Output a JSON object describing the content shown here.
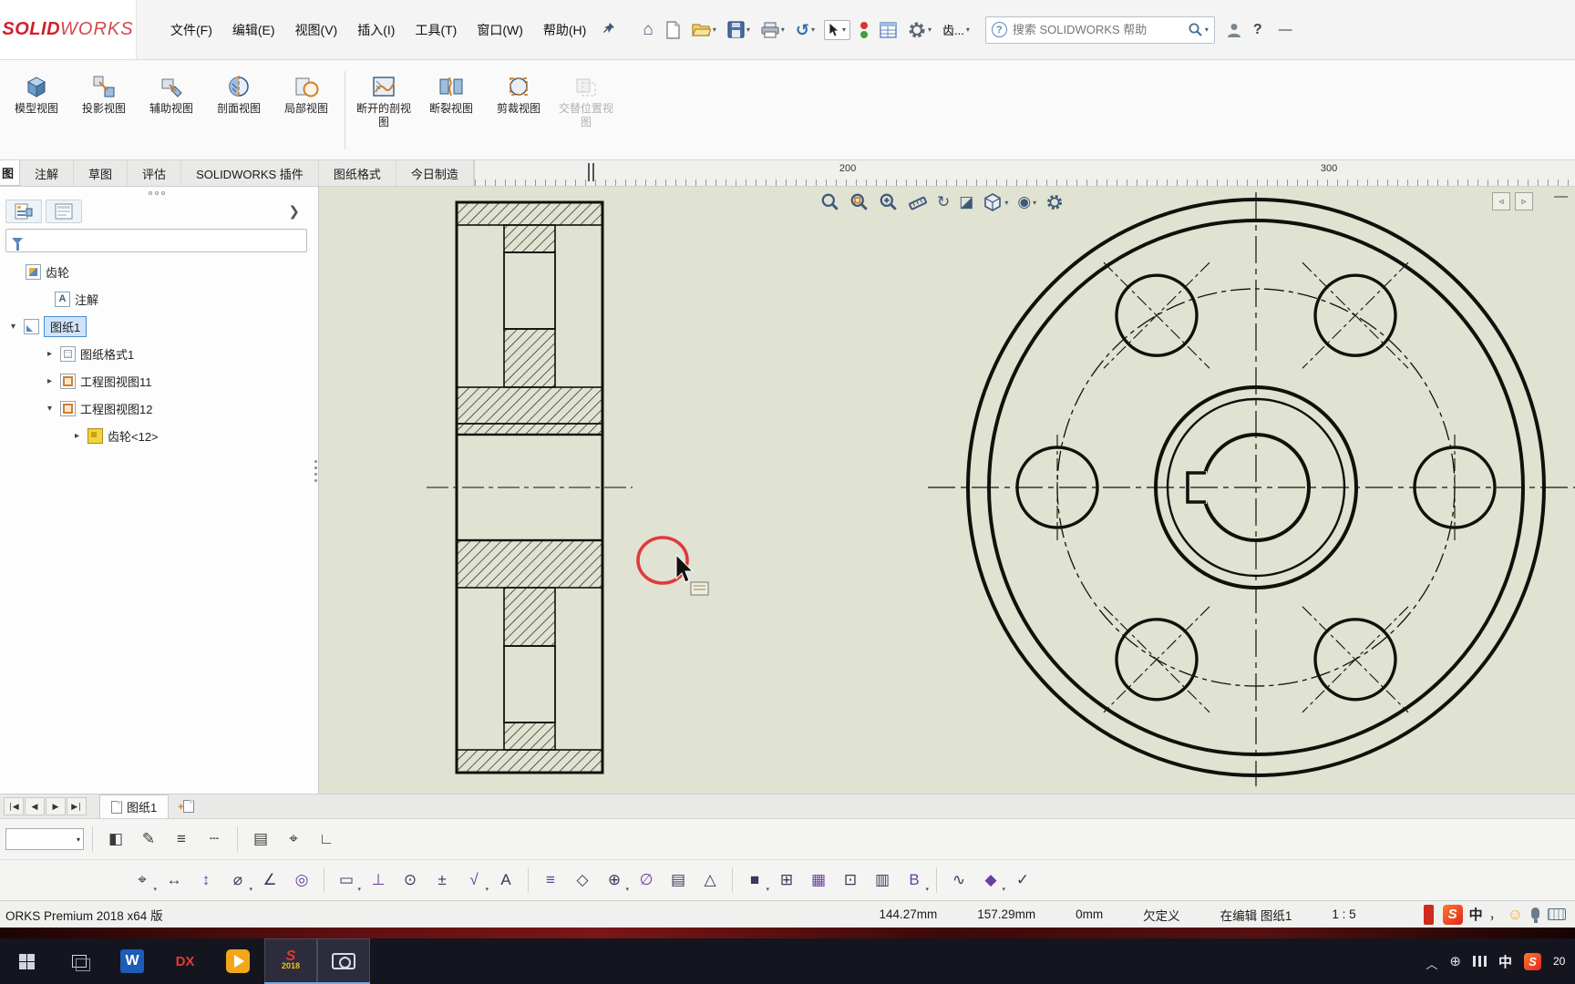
{
  "app": {
    "logo_solid": "SOLID",
    "logo_works": "WORKS",
    "premium": "ORKS Premium 2018 x64 版"
  },
  "menu_bar": {
    "items": [
      "文件(F)",
      "编辑(E)",
      "视图(V)",
      "插入(I)",
      "工具(T)",
      "窗口(W)",
      "帮助(H)"
    ],
    "recent_doc": "齿...",
    "search_placeholder": "搜索 SOLIDWORKS 帮助"
  },
  "ribbon": {
    "buttons": [
      {
        "label": "模型视图"
      },
      {
        "label": "投影视图"
      },
      {
        "label": "辅助视图"
      },
      {
        "label": "剖面视图"
      },
      {
        "label": "局部视图"
      },
      {
        "label": "断开的剖视图"
      },
      {
        "label": "断裂视图"
      },
      {
        "label": "剪裁视图"
      },
      {
        "label": "交替位置视图"
      }
    ]
  },
  "command_tabs": {
    "partial": "图",
    "items": [
      "注解",
      "草图",
      "评估",
      "SOLIDWORKS 插件",
      "图纸格式",
      "今日制造"
    ]
  },
  "ruler": {
    "labels": [
      "200",
      "300"
    ]
  },
  "sidebar": {
    "tree": [
      {
        "label": "齿轮"
      },
      {
        "label": "注解"
      },
      {
        "label": "图纸1",
        "expander": "▾"
      },
      {
        "label": "图纸格式1",
        "expander": "▸"
      },
      {
        "label": "工程图视图11",
        "expander": "▸"
      },
      {
        "label": "工程图视图12",
        "expander": "▾"
      },
      {
        "label": "齿轮<12>",
        "expander": "▸"
      }
    ]
  },
  "sheet_bar": {
    "active_tab": "图纸1"
  },
  "status_bar": {
    "x": "144.27mm",
    "y": "157.29mm",
    "z": "0mm",
    "state": "欠定义",
    "editing": "在编辑 图纸1",
    "scale": "1 : 5",
    "ime_cn": "中",
    "ime_punct": "，",
    "sogou": "S"
  },
  "taskbar": {
    "word": "W",
    "dx": "DX",
    "sw": "S",
    "sw_year": "2018",
    "ime": "中",
    "sogou": "S",
    "clock": "20"
  }
}
